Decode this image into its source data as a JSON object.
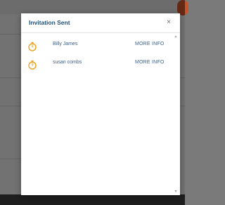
{
  "modal": {
    "title": "Invitation Sent",
    "close_glyph": "×"
  },
  "invites": [
    {
      "name": "Billy James",
      "action_label": "MORE INFO",
      "icon": "stopwatch-icon"
    },
    {
      "name": "susan combs",
      "action_label": "MORE INFO",
      "icon": "stopwatch-icon"
    }
  ],
  "colors": {
    "title": "#1f4f7a",
    "link": "#3b5f86",
    "icon": "#f0a020"
  }
}
